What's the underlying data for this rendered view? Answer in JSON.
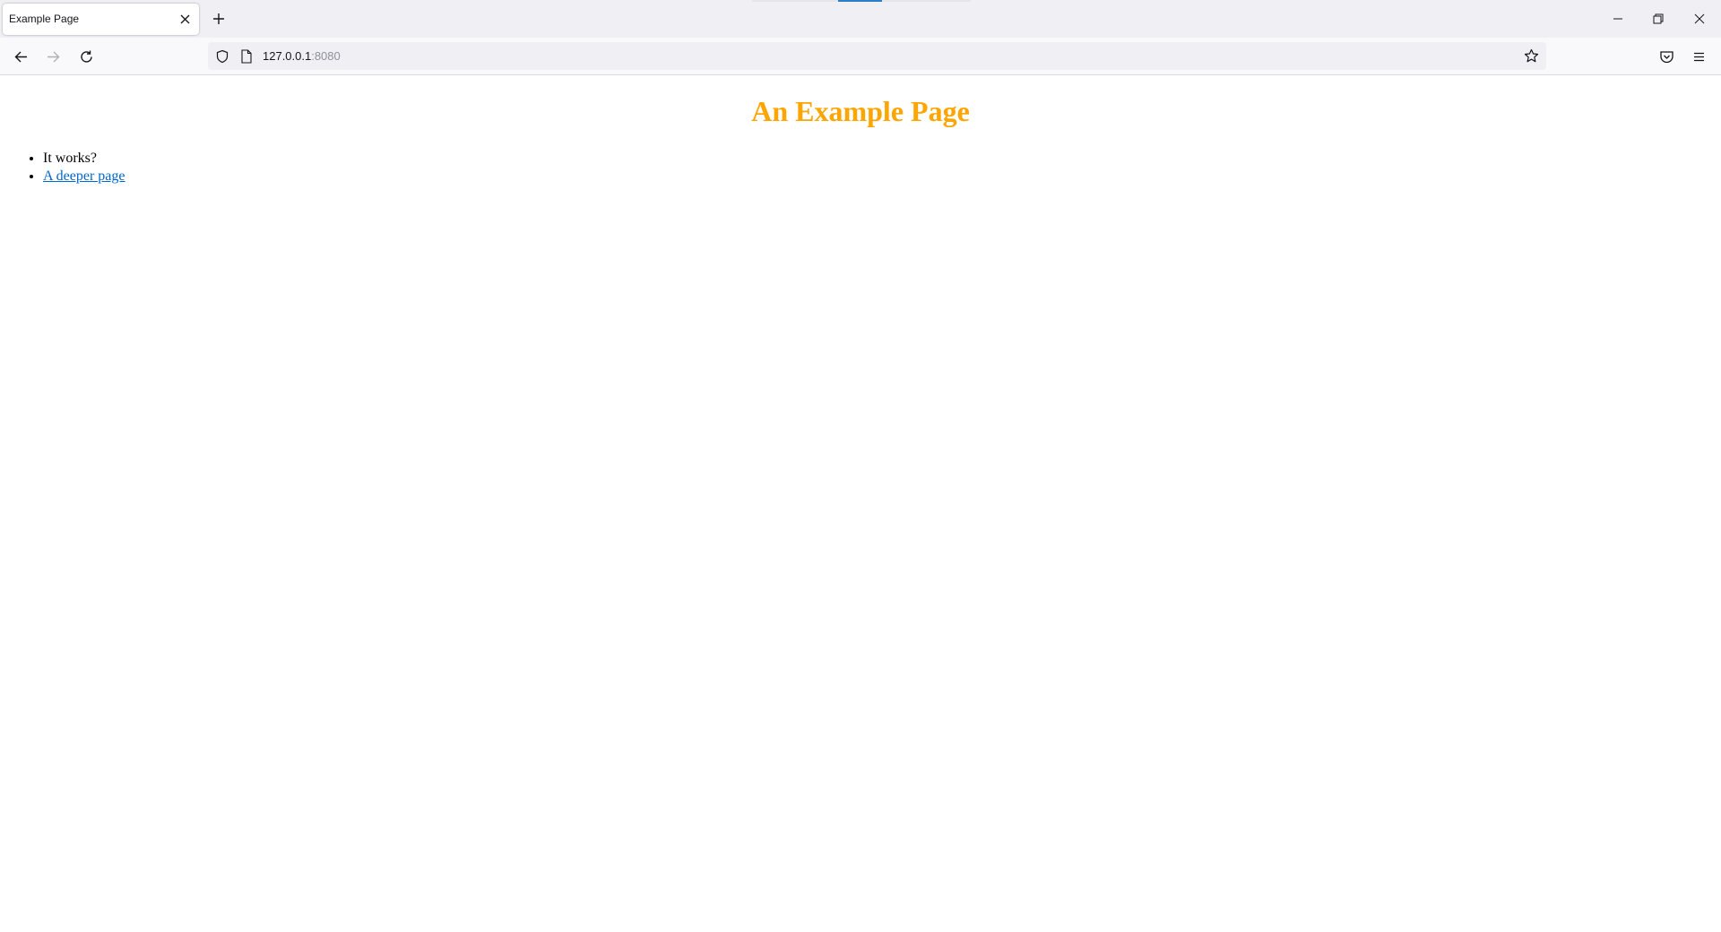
{
  "browser": {
    "tab": {
      "title": "Example Page"
    },
    "address_bar": {
      "host": "127.0.0.1",
      "port": ":8080"
    }
  },
  "page": {
    "heading": "An Example Page",
    "heading_color": "#ffa500",
    "list_items": [
      {
        "text": "It works?"
      },
      {
        "text": "A deeper page",
        "link": true
      }
    ]
  },
  "icons": {
    "tab_close": "close-icon",
    "new_tab": "plus-icon",
    "back": "arrow-left-icon",
    "forward": "arrow-right-icon",
    "reload": "reload-icon",
    "shield": "shield-icon",
    "page": "page-icon",
    "bookmark": "star-icon",
    "pocket": "pocket-icon",
    "menu": "hamburger-menu-icon",
    "minimize": "minimize-icon",
    "restore": "restore-icon",
    "close_window": "close-icon"
  }
}
